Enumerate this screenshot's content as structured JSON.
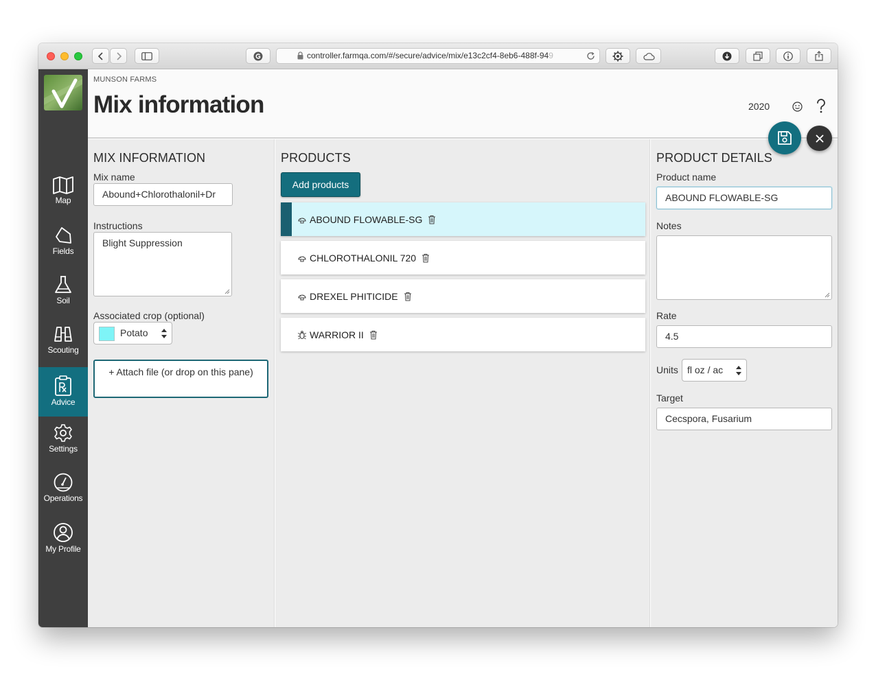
{
  "browser": {
    "url_main": "controller.farmqa.com/#/secure/advice/mix/e13c2cf4-8eb6-488f-94",
    "url_faded": "9"
  },
  "header": {
    "farm_name": "MUNSON FARMS",
    "title": "Mix information",
    "year": "2020"
  },
  "sidebar": {
    "items": [
      {
        "label": "Map",
        "icon": "map-icon"
      },
      {
        "label": "Fields",
        "icon": "fields-icon"
      },
      {
        "label": "Soil",
        "icon": "flask-icon"
      },
      {
        "label": "Scouting",
        "icon": "binoculars-icon"
      },
      {
        "label": "Advice",
        "icon": "prescription-icon",
        "active": true
      },
      {
        "label": "Settings",
        "icon": "gear-icon"
      },
      {
        "label": "Operations",
        "icon": "gauge-icon"
      },
      {
        "label": "My Profile",
        "icon": "user-circle-icon"
      }
    ]
  },
  "mix_info": {
    "title": "MIX INFORMATION",
    "mix_name_label": "Mix name",
    "mix_name_value": "Abound+Chlorothalonil+Dr",
    "instructions_label": "Instructions",
    "instructions_value": "Blight Suppression",
    "crop_label": "Associated crop (optional)",
    "crop_value": "Potato",
    "crop_color": "#7ef4f7",
    "attach_label": "+  Attach file (or drop on this pane)"
  },
  "products": {
    "title": "PRODUCTS",
    "add_label": "Add products",
    "items": [
      {
        "name": "ABOUND FLOWABLE-SG",
        "icon": "fungicide-icon",
        "selected": true
      },
      {
        "name": "CHLOROTHALONIL 720",
        "icon": "fungicide-icon",
        "selected": false
      },
      {
        "name": "DREXEL PHITICIDE",
        "icon": "fungicide-icon",
        "selected": false
      },
      {
        "name": "WARRIOR II",
        "icon": "insecticide-icon",
        "selected": false
      }
    ]
  },
  "product_details": {
    "title": "PRODUCT DETAILS",
    "name_label": "Product name",
    "name_value": "ABOUND FLOWABLE-SG",
    "notes_label": "Notes",
    "notes_value": "",
    "rate_label": "Rate",
    "rate_value": "4.5",
    "units_label": "Units",
    "units_value": "fl oz / ac",
    "target_label": "Target",
    "target_value": "Cecspora, Fusarium"
  },
  "colors": {
    "accent": "#136f80",
    "sidebar": "#3f3f3f",
    "selected_row": "#d6f6fb"
  }
}
